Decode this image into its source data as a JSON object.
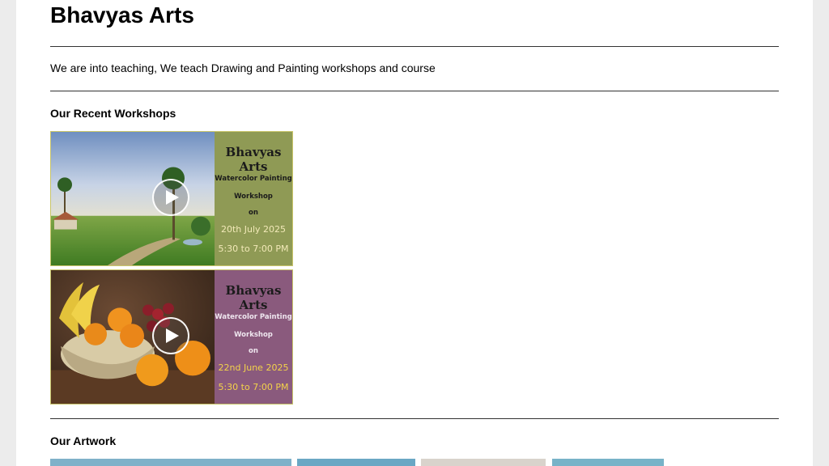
{
  "site": {
    "title": "Bhavyas Arts",
    "tagline": "We are into teaching, We teach Drawing and Painting workshops and course"
  },
  "workshops": {
    "heading": "Our Recent Workshops",
    "items": [
      {
        "brand": "Bhavyas Arts",
        "type": "Watercolor Painting",
        "kind": "Workshop",
        "on": "on",
        "date": "20th July 2025",
        "time": "5:30 to 7:00 PM",
        "panel_color": "#8f9a55",
        "accent_color": "#f2e9b8"
      },
      {
        "brand": "Bhavyas Arts",
        "type": "Watercolor Painting",
        "kind": "Workshop",
        "on": "on",
        "date": "22nd June 2025",
        "time": "5:30 to 7:00 PM",
        "panel_color": "#8a5a7d",
        "accent_color": "#f3d34a"
      }
    ]
  },
  "artwork": {
    "heading": "Our Artwork"
  }
}
